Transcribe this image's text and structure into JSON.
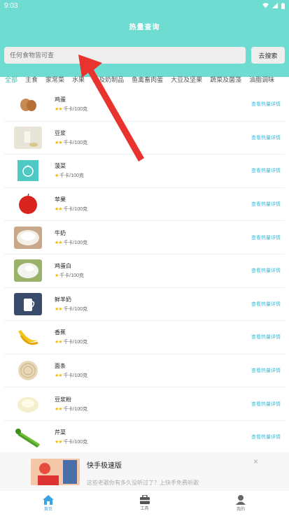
{
  "status": {
    "time": "9:03"
  },
  "header": {
    "title": "热量查询"
  },
  "search": {
    "placeholder": "任何食物皆可查",
    "button": "去搜索"
  },
  "tabs": [
    "全部",
    "主食",
    "家常菜",
    "水果",
    "奶及奶制品",
    "鱼禽畜肉蛋",
    "大豆及坚果",
    "蔬菜及菌藻",
    "油脂调味"
  ],
  "foods": [
    {
      "name": "鸡蛋",
      "unit": "千卡/100克",
      "detail": "查看热量详情",
      "icon": "egg-icon"
    },
    {
      "name": "豆浆",
      "unit": "千卡/100克",
      "detail": "查看热量详情",
      "icon": "soy-milk-icon"
    },
    {
      "name": "菠菜",
      "unit": "千卡/100克",
      "detail": "查看热量详情",
      "icon": "spinach-icon"
    },
    {
      "name": "苹果",
      "unit": "千卡/100克",
      "detail": "查看热量详情",
      "icon": "apple-icon"
    },
    {
      "name": "牛奶",
      "unit": "千卡/100克",
      "detail": "查看热量详情",
      "icon": "milk-icon"
    },
    {
      "name": "鸡蛋白",
      "unit": "千卡/100克",
      "detail": "查看热量详情",
      "icon": "egg-white-icon"
    },
    {
      "name": "鲜羊奶",
      "unit": "千卡/100克",
      "detail": "查看热量详情",
      "icon": "goat-milk-icon"
    },
    {
      "name": "香蕉",
      "unit": "千卡/100克",
      "detail": "查看热量详情",
      "icon": "banana-icon"
    },
    {
      "name": "面条",
      "unit": "千卡/100克",
      "detail": "查看热量详情",
      "icon": "noodles-icon"
    },
    {
      "name": "豆浆粉",
      "unit": "千卡/100克",
      "detail": "查看热量详情",
      "icon": "soy-powder-icon"
    },
    {
      "name": "芹菜",
      "unit": "千卡/100克",
      "detail": "查看热量详情",
      "icon": "celery-icon"
    }
  ],
  "ad": {
    "title": "快手极速版",
    "subtitle": "这些老歌你有多久没听过了？上快手免费听歌",
    "close": "×"
  },
  "nav": [
    {
      "label": "首页",
      "icon": "home-icon"
    },
    {
      "label": "工具",
      "icon": "toolbox-icon"
    },
    {
      "label": "我的",
      "icon": "profile-icon"
    }
  ],
  "colors": {
    "header": "#6fdcd2",
    "accent": "#2fbfb3",
    "link": "#3bbcd8",
    "stars": "#f5b800",
    "arrow": "#e8332e"
  }
}
